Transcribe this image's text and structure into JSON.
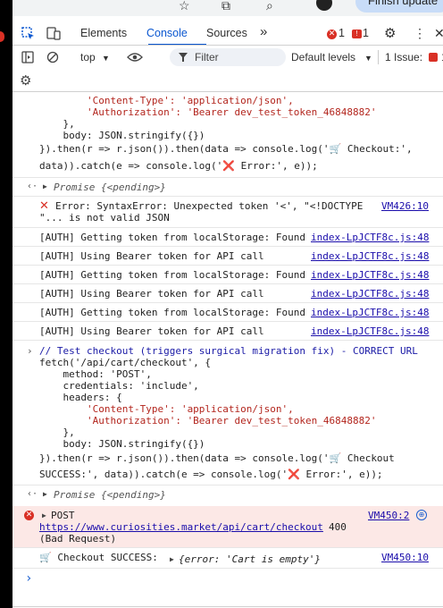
{
  "browser": {
    "finish_update_label": "Finish update"
  },
  "devtools": {
    "tabs": [
      "Elements",
      "Console",
      "Sources"
    ],
    "active_tab": "Console",
    "more_tabs": "»",
    "error_count": "1",
    "warning_count": "1",
    "toolbar": {
      "context": "top",
      "filter_placeholder": "Filter",
      "levels": "Default levels",
      "issues": "1 Issue:",
      "issues_count": "1"
    }
  },
  "console": {
    "block1": [
      "        'Content-Type': 'application/json',",
      "        'Authorization': 'Bearer dev_test_token_46848882'",
      "    },",
      "    body: JSON.stringify({})",
      "}).then(r => r.json()).then(data => console.log('🛒 Checkout:',",
      "data)).catch(e => console.log('❌ Error:', e));"
    ],
    "promise1": "Promise {<pending>}",
    "syntax_error_line1": "Error: SyntaxError: Unexpected token '<', \"<!DOCTYPE",
    "syntax_error_line2": "\"... is not valid JSON",
    "syntax_error_source": "VM426:10",
    "auth_logs": [
      {
        "text": "[AUTH] Getting token from localStorage: Found",
        "source": "index-LpJCTF8c.js:48"
      },
      {
        "text": "[AUTH] Using Bearer token for API call",
        "source": "index-LpJCTF8c.js:48"
      },
      {
        "text": "[AUTH] Getting token from localStorage: Found",
        "source": "index-LpJCTF8c.js:48"
      },
      {
        "text": "[AUTH] Using Bearer token for API call",
        "source": "index-LpJCTF8c.js:48"
      },
      {
        "text": "[AUTH] Getting token from localStorage: Found",
        "source": "index-LpJCTF8c.js:48"
      },
      {
        "text": "[AUTH] Using Bearer token for API call",
        "source": "index-LpJCTF8c.js:48"
      }
    ],
    "block2_comment": "// Test checkout (triggers surgical migration fix) - CORRECT URL",
    "block2": [
      "fetch('/api/cart/checkout', {",
      "    method: 'POST',",
      "    credentials: 'include',",
      "    headers: {",
      "        'Content-Type': 'application/json',",
      "        'Authorization': 'Bearer dev_test_token_46848882'",
      "    },",
      "    body: JSON.stringify({})",
      "}).then(r => r.json()).then(data => console.log('🛒 Checkout",
      "SUCCESS:', data)).catch(e => console.log('❌ Error:', e));"
    ],
    "promise2": "Promise {<pending>}",
    "post_method": "POST",
    "post_source": "VM450:2",
    "post_url": "https://www.curiosities.market/api/cart/checkout",
    "post_status": "400",
    "post_status_text": "(Bad Request)",
    "success_label": "🛒 Checkout SUCCESS:",
    "success_obj": "{error: 'Cart is empty'}",
    "success_source": "VM450:10",
    "prompt": "›"
  }
}
